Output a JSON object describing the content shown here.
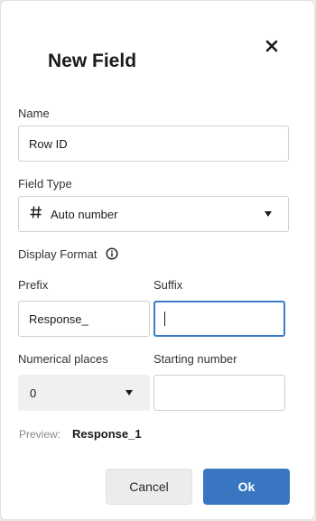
{
  "dialog": {
    "title": "New Field"
  },
  "name": {
    "label": "Name",
    "value": "Row ID"
  },
  "field_type": {
    "label": "Field Type",
    "value": "Auto number"
  },
  "display_format": {
    "label": "Display Format"
  },
  "prefix": {
    "label": "Prefix",
    "value": "Response_"
  },
  "suffix": {
    "label": "Suffix",
    "value": ""
  },
  "numerical_places": {
    "label": "Numerical places",
    "value": "0"
  },
  "starting_number": {
    "label": "Starting number",
    "value": ""
  },
  "preview": {
    "label": "Preview:",
    "value": "Response_1"
  },
  "buttons": {
    "cancel": "Cancel",
    "ok": "Ok"
  },
  "colors": {
    "primary": "#3876c2",
    "focus_border": "#3a7bc8"
  }
}
